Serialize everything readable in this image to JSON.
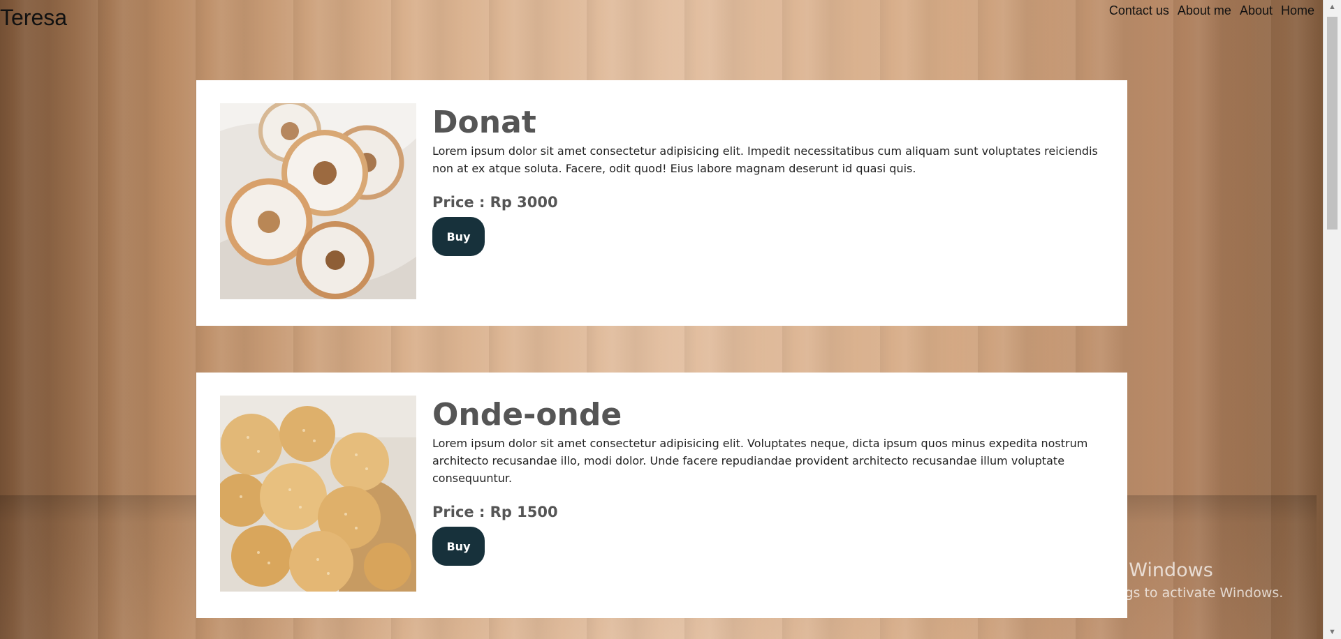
{
  "header": {
    "brand": "Teresa",
    "nav": [
      "Contact us",
      "About me",
      "About",
      "Home"
    ]
  },
  "products": [
    {
      "name": "Donat",
      "description": "Lorem ipsum dolor sit amet consectetur adipisicing elit. Impedit necessitatibus cum aliquam sunt voluptates reiciendis non at ex atque soluta. Facere, odit quod! Eius labore magnam deserunt id quasi quis.",
      "price": "Price : Rp 3000",
      "buy_label": "Buy"
    },
    {
      "name": "Onde-onde",
      "description": "Lorem ipsum dolor sit amet consectetur adipisicing elit. Voluptates neque, dicta ipsum quos minus expedita nostrum architecto recusandae illo, modi dolor. Unde facere repudiandae provident architecto recusandae illum voluptate consequuntur.",
      "price": "Price : Rp 1500",
      "buy_label": "Buy"
    }
  ],
  "watermark": {
    "line1": "Activate Windows",
    "line2": "Go to Settings to activate Windows."
  },
  "colors": {
    "button": "#17313b",
    "title": "#555555"
  }
}
